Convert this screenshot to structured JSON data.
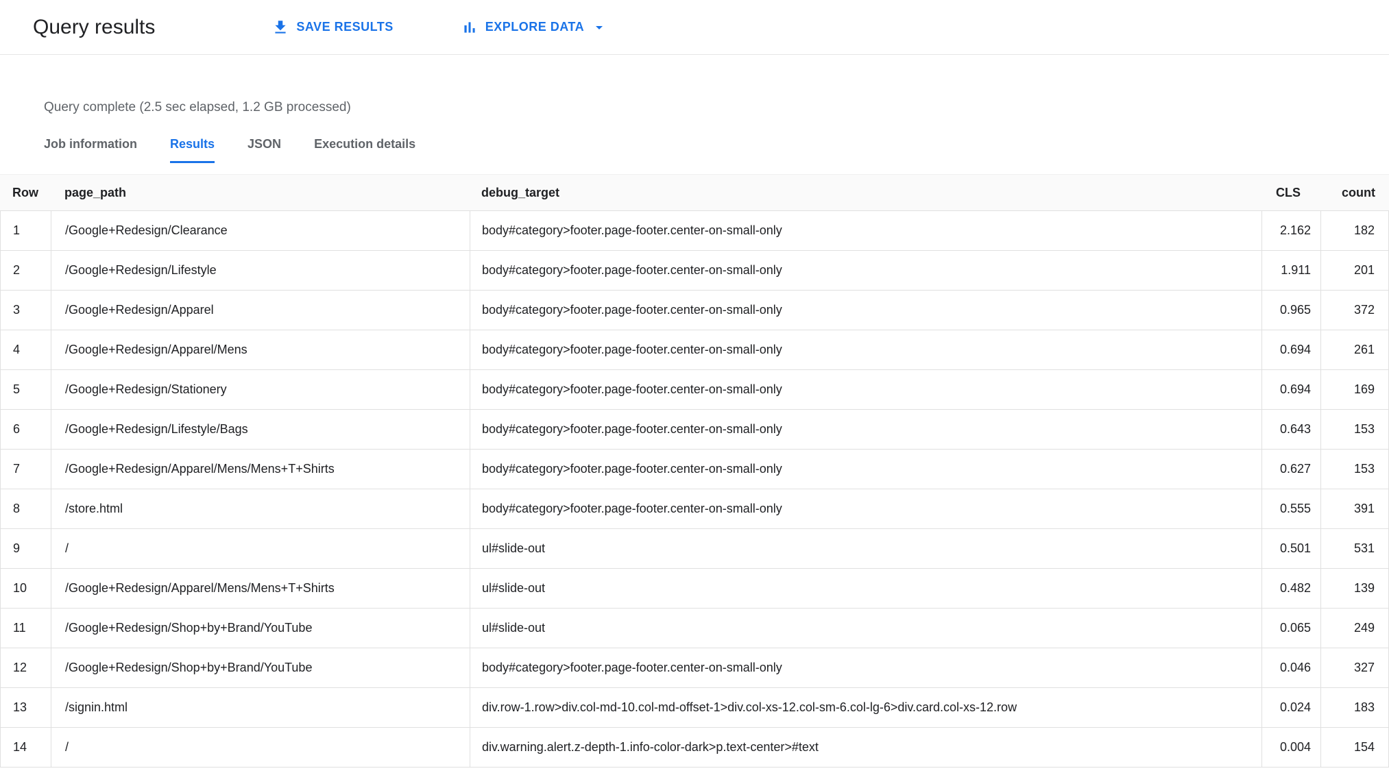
{
  "header": {
    "title": "Query results",
    "save_results_label": "SAVE RESULTS",
    "explore_data_label": "EXPLORE DATA"
  },
  "status": {
    "text": "Query complete (2.5 sec elapsed, 1.2 GB processed)"
  },
  "tabs": [
    {
      "label": "Job information",
      "active": false
    },
    {
      "label": "Results",
      "active": true
    },
    {
      "label": "JSON",
      "active": false
    },
    {
      "label": "Execution details",
      "active": false
    }
  ],
  "icons": {
    "save": "download-icon",
    "explore": "bar-chart-icon",
    "explore_caret": "dropdown-arrow-icon"
  },
  "colors": {
    "accent_blue": "#1a73e8",
    "text_primary": "#202124",
    "text_secondary": "#5f6368",
    "border": "#e0e0e0",
    "table_header_bg": "#fafafa"
  },
  "table": {
    "columns": [
      "Row",
      "page_path",
      "debug_target",
      "CLS",
      "count"
    ],
    "rows": [
      {
        "row": "1",
        "page_path": "/Google+Redesign/Clearance",
        "debug_target": "body#category>footer.page-footer.center-on-small-only",
        "cls": "2.162",
        "count": "182"
      },
      {
        "row": "2",
        "page_path": "/Google+Redesign/Lifestyle",
        "debug_target": "body#category>footer.page-footer.center-on-small-only",
        "cls": "1.911",
        "count": "201"
      },
      {
        "row": "3",
        "page_path": "/Google+Redesign/Apparel",
        "debug_target": "body#category>footer.page-footer.center-on-small-only",
        "cls": "0.965",
        "count": "372"
      },
      {
        "row": "4",
        "page_path": "/Google+Redesign/Apparel/Mens",
        "debug_target": "body#category>footer.page-footer.center-on-small-only",
        "cls": "0.694",
        "count": "261"
      },
      {
        "row": "5",
        "page_path": "/Google+Redesign/Stationery",
        "debug_target": "body#category>footer.page-footer.center-on-small-only",
        "cls": "0.694",
        "count": "169"
      },
      {
        "row": "6",
        "page_path": "/Google+Redesign/Lifestyle/Bags",
        "debug_target": "body#category>footer.page-footer.center-on-small-only",
        "cls": "0.643",
        "count": "153"
      },
      {
        "row": "7",
        "page_path": "/Google+Redesign/Apparel/Mens/Mens+T+Shirts",
        "debug_target": "body#category>footer.page-footer.center-on-small-only",
        "cls": "0.627",
        "count": "153"
      },
      {
        "row": "8",
        "page_path": "/store.html",
        "debug_target": "body#category>footer.page-footer.center-on-small-only",
        "cls": "0.555",
        "count": "391"
      },
      {
        "row": "9",
        "page_path": "/",
        "debug_target": "ul#slide-out",
        "cls": "0.501",
        "count": "531"
      },
      {
        "row": "10",
        "page_path": "/Google+Redesign/Apparel/Mens/Mens+T+Shirts",
        "debug_target": "ul#slide-out",
        "cls": "0.482",
        "count": "139"
      },
      {
        "row": "11",
        "page_path": "/Google+Redesign/Shop+by+Brand/YouTube",
        "debug_target": "ul#slide-out",
        "cls": "0.065",
        "count": "249"
      },
      {
        "row": "12",
        "page_path": "/Google+Redesign/Shop+by+Brand/YouTube",
        "debug_target": "body#category>footer.page-footer.center-on-small-only",
        "cls": "0.046",
        "count": "327"
      },
      {
        "row": "13",
        "page_path": "/signin.html",
        "debug_target": "div.row-1.row>div.col-md-10.col-md-offset-1>div.col-xs-12.col-sm-6.col-lg-6>div.card.col-xs-12.row",
        "cls": "0.024",
        "count": "183"
      },
      {
        "row": "14",
        "page_path": "/",
        "debug_target": "div.warning.alert.z-depth-1.info-color-dark>p.text-center>#text",
        "cls": "0.004",
        "count": "154"
      }
    ]
  }
}
